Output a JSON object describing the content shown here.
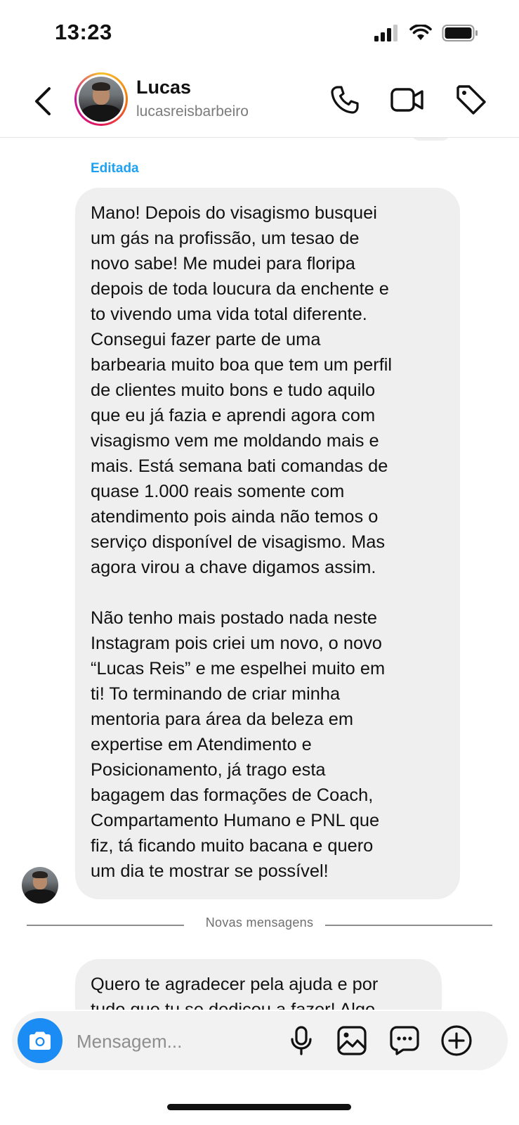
{
  "status_bar": {
    "time": "13:23"
  },
  "header": {
    "name": "Lucas",
    "username": "lucasreisbarbeiro"
  },
  "chat": {
    "edited_label": "Editada",
    "message_1_paragraphs": [
      "Mano! Depois do visagismo busquei\num gás na profissão, um tesao de\nnovo sabe! Me mudei para floripa\ndepois de toda loucura da enchente e\nto vivendo uma vida total diferente.\nConsegui fazer parte de uma\nbarbearia muito boa que tem um perfil\nde clientes muito bons e tudo aquilo\nque eu já fazia e aprendi agora com\nvisagismo vem me moldando mais e\nmais. Está semana bati comandas de\nquase 1.000 reais somente com\natendimento pois ainda não temos o\nserviço disponível de visagismo. Mas\nagora virou a chave digamos assim.",
      "Não tenho mais postado nada neste\nInstagram pois criei um novo, o novo\n“Lucas Reis” e me espelhei muito em\nti! To terminando de criar minha\nmentoria para área da beleza em\nexpertise em Atendimento e\nPosicionamento, já trago esta\nbagagem das formações de Coach,\nCompartamento Humano e PNL que\nfiz, tá ficando muito bacana e quero\num dia te mostrar se possível!"
    ],
    "new_messages_divider": "Novas mensagens",
    "message_2": "Quero te agradecer pela ajuda e por\ntudo que tu se dedicou a fazer! Algo"
  },
  "composer": {
    "placeholder": "Mensagem..."
  },
  "colors": {
    "accent_blue": "#1a8cf3",
    "edited_blue": "#1fa1f2",
    "bubble_bg": "#efefef"
  },
  "icons": [
    "signal-icon",
    "wifi-icon",
    "battery-icon",
    "back-icon",
    "phone-icon",
    "video-icon",
    "tag-icon",
    "camera-icon",
    "microphone-icon",
    "gallery-icon",
    "sticker-icon",
    "plus-icon"
  ]
}
